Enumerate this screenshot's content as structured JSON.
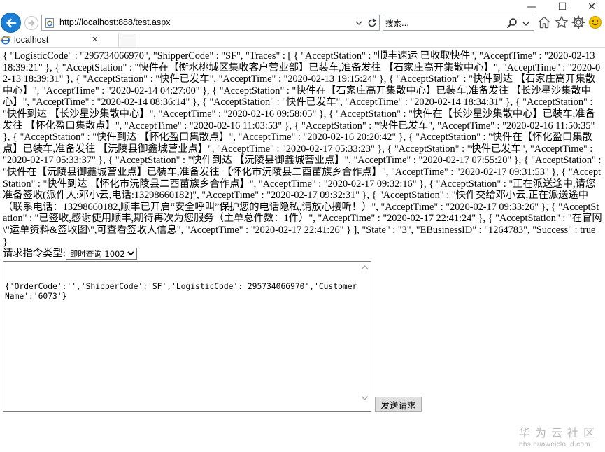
{
  "window": {
    "min_glyph": "—",
    "max_glyph": "☐",
    "close_glyph": "✕"
  },
  "address": {
    "prefix": "http://",
    "host": "localhost",
    "path": ":888/test.aspx"
  },
  "search": {
    "placeholder": "搜索..."
  },
  "tab": {
    "label": "localhost",
    "close_glyph": "✕"
  },
  "page": {
    "response_json": "{ \"LogisticCode\" : \"295734066970\", \"ShipperCode\" : \"SF\", \"Traces\" : [ { \"AcceptStation\" : \"顺丰速运 已收取快件\", \"AcceptTime\" : \"2020-02-13 18:39:21\" }, { \"AcceptStation\" : \"快件在【衡水桃城区集收客户营业部】已装车,准备发往 【石家庄高开集散中心】\", \"AcceptTime\" : \"2020-02-13 18:39:31\" }, { \"AcceptStation\" : \"快件已发车\", \"AcceptTime\" : \"2020-02-13 19:15:24\" }, { \"AcceptStation\" : \"快件到达 【石家庄高开集散中心】\", \"AcceptTime\" : \"2020-02-14 04:27:00\" }, { \"AcceptStation\" : \"快件在【石家庄高开集散中心】已装车,准备发往 【长沙星沙集散中心】\", \"AcceptTime\" : \"2020-02-14 08:36:14\" }, { \"AcceptStation\" : \"快件已发车\", \"AcceptTime\" : \"2020-02-14 18:34:31\" }, { \"AcceptStation\" : \"快件到达 【长沙星沙集散中心】\", \"AcceptTime\" : \"2020-02-16 09:58:05\" }, { \"AcceptStation\" : \"快件在【长沙星沙集散中心】已装车,准备发往 【怀化盈口集散点】\", \"AcceptTime\" : \"2020-02-16 11:03:53\" }, { \"AcceptStation\" : \"快件已发车\", \"AcceptTime\" : \"2020-02-16 11:50:35\" }, { \"AcceptStation\" : \"快件到达 【怀化盈口集散点】\", \"AcceptTime\" : \"2020-02-16 20:20:42\" }, { \"AcceptStation\" : \"快件在【怀化盈口集散点】已装车,准备发往 【沅陵县御鑫城营业点】\", \"AcceptTime\" : \"2020-02-17 05:33:23\" }, { \"AcceptStation\" : \"快件已发车\", \"AcceptTime\" : \"2020-02-17 05:33:37\" }, { \"AcceptStation\" : \"快件到达 【沅陵县御鑫城营业点】\", \"AcceptTime\" : \"2020-02-17 07:55:20\" }, { \"AcceptStation\" : \"快件在【沅陵县御鑫城营业点】已装车,准备发往 【怀化市沅陵县二酉苗族乡合作点】\", \"AcceptTime\" : \"2020-02-17 09:31:53\" }, { \"AcceptStation\" : \"快件到达 【怀化市沅陵县二酉苗族乡合作点】\", \"AcceptTime\" : \"2020-02-17 09:32:16\" }, { \"AcceptStation\" : \"正在派送途中,请您准备签收(派件人:邓小云,电话:13298660182)\", \"AcceptTime\" : \"2020-02-17 09:32:31\" }, { \"AcceptStation\" : \"快件交给邓小云,正在派送途中（联系电话：13298660182,顺丰已开启“安全呼叫”保护您的电话隐私,请放心接听！）\", \"AcceptTime\" : \"2020-02-17 09:33:26\" }, { \"AcceptStation\" : \"已签收,感谢使用顺丰,期待再次为您服务（主单总件数：1件）\", \"AcceptTime\" : \"2020-02-17 22:41:24\" }, { \"AcceptStation\" : \"在官网\\\"运单资料&签收图\\\",可查看签收人信息\", \"AcceptTime\" : \"2020-02-17 22:41:26\" } ], \"State\" : \"3\", \"EBusinessID\" : \"1264783\", \"Success\" : true }",
    "cmd_label": "请求指令类型:",
    "cmd_selected": "即时查询 1002",
    "request_body": "{'OrderCode':'','ShipperCode':'SF','LogisticCode':'295734066970','CustomerName':'6073'}",
    "send_label": "发送请求"
  },
  "watermark": {
    "main": "华为云社区",
    "sub": "bbs.huaweicloud.com"
  },
  "colors": {
    "back_button": "#1b7fd6",
    "ie_icon": "#2a74c9",
    "smiley": "#f5c200"
  }
}
